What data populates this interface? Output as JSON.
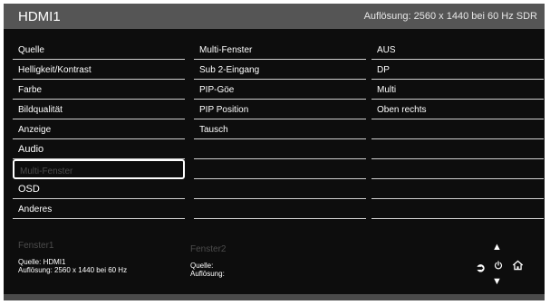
{
  "header": {
    "input_name": "HDMI1",
    "resolution": "Auflösung: 2560 x 1440 bei 60 Hz SDR"
  },
  "menu": {
    "col1": [
      "Quelle",
      "Helligkeit/Kontrast",
      "Farbe",
      "Bildqualität",
      "Anzeige",
      "Audio",
      "Multi-Fenster",
      "OSD",
      "Anderes"
    ],
    "col2": [
      "Multi-Fenster",
      "Sub 2-Eingang",
      "PIP-Göe",
      "PIP Position",
      "Tausch",
      "",
      "",
      "",
      ""
    ],
    "col3": [
      "AUS",
      "DP",
      "Multi",
      "Oben rechts",
      "",
      "",
      "",
      "",
      ""
    ]
  },
  "fenster1": {
    "title": "Fenster1",
    "source": "Quelle: HDMI1",
    "resolution": "Auflösung: 2560 x 1440 bei 60 Hz"
  },
  "fenster2": {
    "title": "Fenster2",
    "source": "Quelle:",
    "resolution": "Auflösung:"
  },
  "icons": {
    "up": "arrow-up-icon",
    "down": "arrow-down-icon",
    "input": "input-source-icon",
    "power": "power-icon",
    "home": "home-icon"
  },
  "colors": {
    "background": "#0d0d0d",
    "header": "#555555",
    "text": "#ffffff",
    "disabled_text": "#4c4c4c",
    "divider": "#d0d0d0"
  }
}
